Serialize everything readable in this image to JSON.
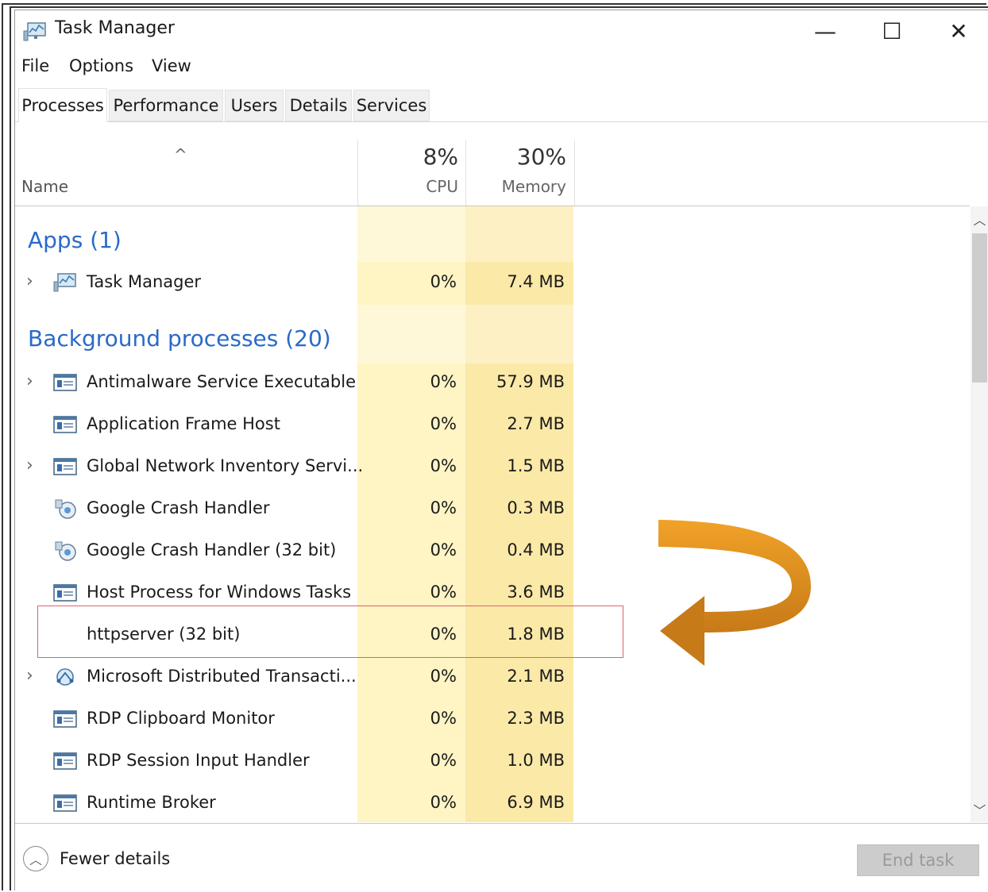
{
  "window": {
    "title": "Task Manager",
    "icon": "task-manager-icon",
    "controls": {
      "minimize": "—",
      "maximize": "☐",
      "close": "✕"
    }
  },
  "menu": [
    "File",
    "Options",
    "View"
  ],
  "tabs": [
    {
      "label": "Processes",
      "active": true
    },
    {
      "label": "Performance",
      "active": false
    },
    {
      "label": "Users",
      "active": false
    },
    {
      "label": "Details",
      "active": false
    },
    {
      "label": "Services",
      "active": false
    }
  ],
  "columns": {
    "name": "Name",
    "cpu": {
      "percent": "8%",
      "label": "CPU"
    },
    "memory": {
      "percent": "30%",
      "label": "Memory"
    }
  },
  "groups": {
    "apps": "Apps (1)",
    "background": "Background processes (20)"
  },
  "apps": [
    {
      "name": "Task Manager",
      "cpu": "0%",
      "memory": "7.4 MB",
      "expandable": true,
      "icon": "task-manager-icon"
    }
  ],
  "background": [
    {
      "name": "Antimalware Service Executable",
      "cpu": "0%",
      "memory": "57.9 MB",
      "expandable": true,
      "icon": "service-window-icon"
    },
    {
      "name": "Application Frame Host",
      "cpu": "0%",
      "memory": "2.7 MB",
      "expandable": false,
      "icon": "service-window-icon"
    },
    {
      "name": "Global Network Inventory Servi...",
      "cpu": "0%",
      "memory": "1.5 MB",
      "expandable": true,
      "icon": "service-window-icon"
    },
    {
      "name": "Google Crash Handler",
      "cpu": "0%",
      "memory": "0.3 MB",
      "expandable": false,
      "icon": "google-crash-icon"
    },
    {
      "name": "Google Crash Handler (32 bit)",
      "cpu": "0%",
      "memory": "0.4 MB",
      "expandable": false,
      "icon": "google-crash-icon"
    },
    {
      "name": "Host Process for Windows Tasks",
      "cpu": "0%",
      "memory": "3.6 MB",
      "expandable": false,
      "icon": "service-window-icon"
    },
    {
      "name": "httpserver (32 bit)",
      "cpu": "0%",
      "memory": "1.8 MB",
      "expandable": false,
      "icon": "",
      "highlighted": true
    },
    {
      "name": "Microsoft Distributed Transacti...",
      "cpu": "0%",
      "memory": "2.1 MB",
      "expandable": true,
      "icon": "distributed-transaction-icon"
    },
    {
      "name": "RDP Clipboard Monitor",
      "cpu": "0%",
      "memory": "2.3 MB",
      "expandable": false,
      "icon": "service-window-icon"
    },
    {
      "name": "RDP Session Input Handler",
      "cpu": "0%",
      "memory": "1.0 MB",
      "expandable": false,
      "icon": "service-window-icon"
    },
    {
      "name": "Runtime Broker",
      "cpu": "0%",
      "memory": "6.9 MB",
      "expandable": false,
      "icon": "service-window-icon"
    }
  ],
  "footer": {
    "fewer_details": "Fewer details",
    "end_task": "End task"
  },
  "colors": {
    "group_header": "#2a6ac8",
    "cpu_column_bg": "#fff4c4",
    "memory_column_bg": "#fbe9a8",
    "highlight_box": "#e06070",
    "annotation_arrow": "#e39420"
  }
}
